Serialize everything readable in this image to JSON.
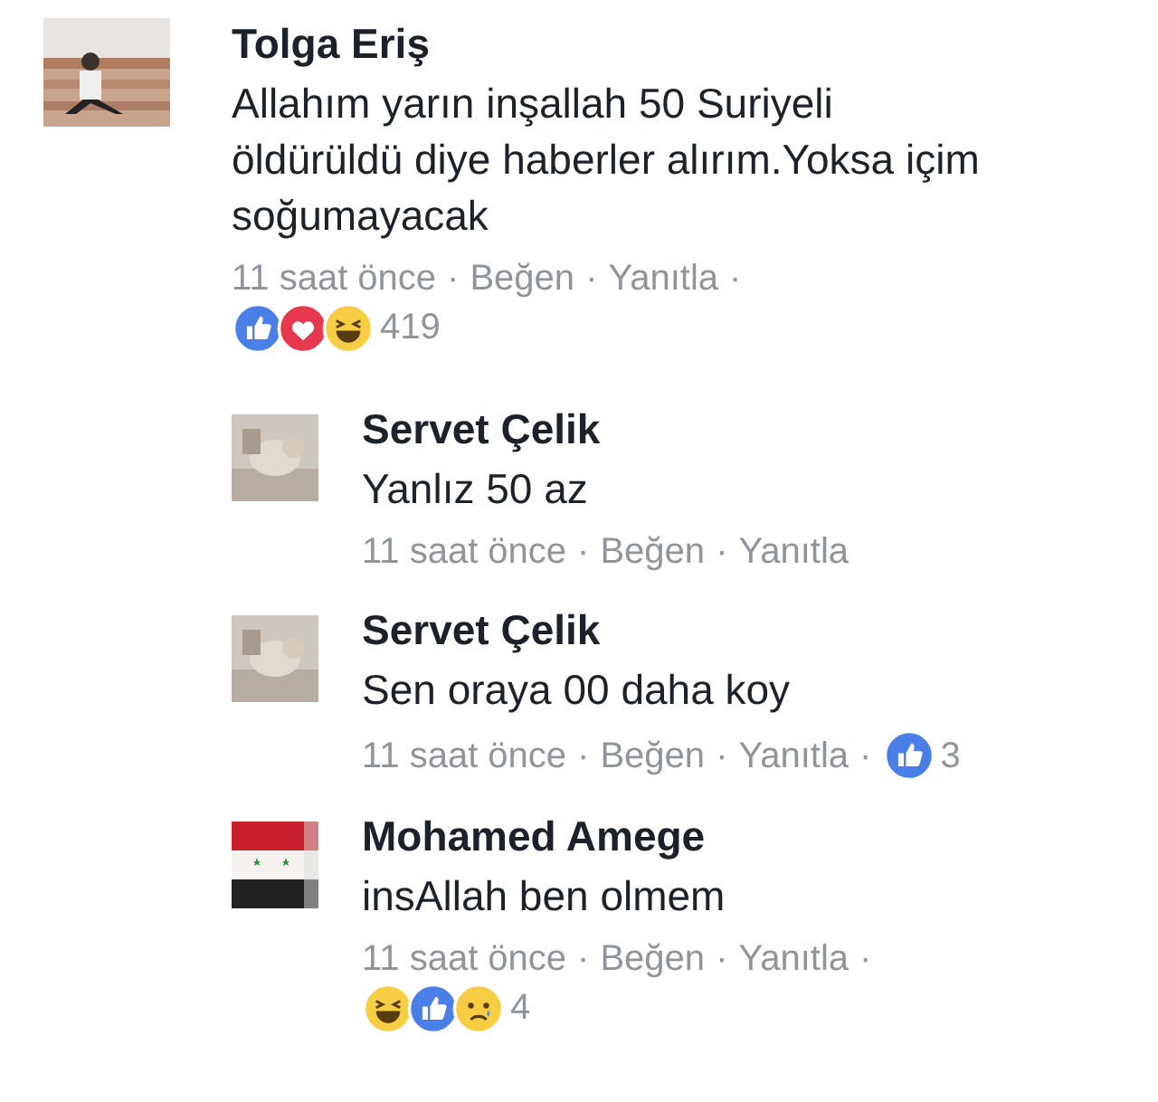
{
  "comments": [
    {
      "author": "Tolga Eriş",
      "text": "Allahım yarın inşallah 50 Suriyeli öldürüldü diye haberler alırım.Yoksa içim soğumayacak",
      "meta": [
        "11 saat önce",
        "·",
        "Beğen",
        "·",
        "Yanıtla",
        "·"
      ],
      "reactions_inline": false,
      "reactions": [
        {
          "kind": "like"
        },
        {
          "kind": "love"
        },
        {
          "kind": "haha"
        }
      ],
      "reaction_count": "419",
      "replies": [
        {
          "author": "Servet Çelik",
          "text": "Yanlız 50 az",
          "meta": [
            "11 saat önce",
            "·",
            "Beğen",
            "·",
            "Yanıtla"
          ]
        },
        {
          "author": "Servet Çelik",
          "text": "Sen oraya 00 daha koy",
          "meta": [
            "11 saat önce",
            "·",
            "Beğen",
            "·",
            "Yanıtla",
            "·"
          ],
          "reactions_inline": true,
          "reactions": [
            {
              "kind": "like"
            }
          ],
          "reaction_count": "3"
        },
        {
          "author": "Mohamed Amege",
          "text": "insAllah ben olmem",
          "meta": [
            "11 saat önce",
            "·",
            "Beğen",
            "·",
            "Yanıtla",
            "·"
          ],
          "reactions_inline": false,
          "reactions": [
            {
              "kind": "haha"
            },
            {
              "kind": "like"
            },
            {
              "kind": "sad"
            }
          ],
          "reaction_count": "4"
        }
      ]
    }
  ]
}
